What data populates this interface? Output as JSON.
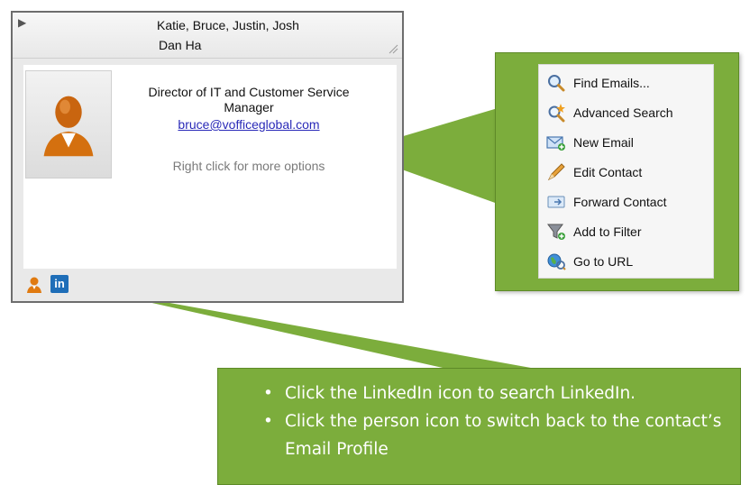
{
  "card": {
    "header": {
      "recipients_line1": "Katie, Bruce, Justin, Josh",
      "recipients_line2": "Dan Ha"
    },
    "contact": {
      "title": "Director of IT and Customer Service Manager",
      "email": "bruce@vofficeglobal.com",
      "hint": "Right click for more options"
    },
    "footer": {
      "person_icon": "person-icon",
      "linkedin_icon": "linkedin-icon",
      "linkedin_label": "in"
    }
  },
  "context_menu": {
    "items": [
      {
        "label": "Find Emails...",
        "icon": "magnifier-icon"
      },
      {
        "label": "Advanced Search",
        "icon": "advanced-search-icon"
      },
      {
        "label": "New Email",
        "icon": "new-email-icon"
      },
      {
        "label": "Edit Contact",
        "icon": "pencil-icon"
      },
      {
        "label": "Forward Contact",
        "icon": "forward-contact-icon"
      },
      {
        "label": "Add to Filter",
        "icon": "filter-icon"
      },
      {
        "label": "Go to URL",
        "icon": "globe-icon"
      }
    ]
  },
  "tips": [
    "Click the LinkedIn icon to search LinkedIn.",
    "Click the person icon to switch back to the contact’s Email Profile"
  ],
  "colors": {
    "callout_green": "#7cad3c",
    "callout_border": "#5e8a28",
    "link_blue": "#2a2ab8",
    "linkedin_blue": "#1f6eb8"
  }
}
